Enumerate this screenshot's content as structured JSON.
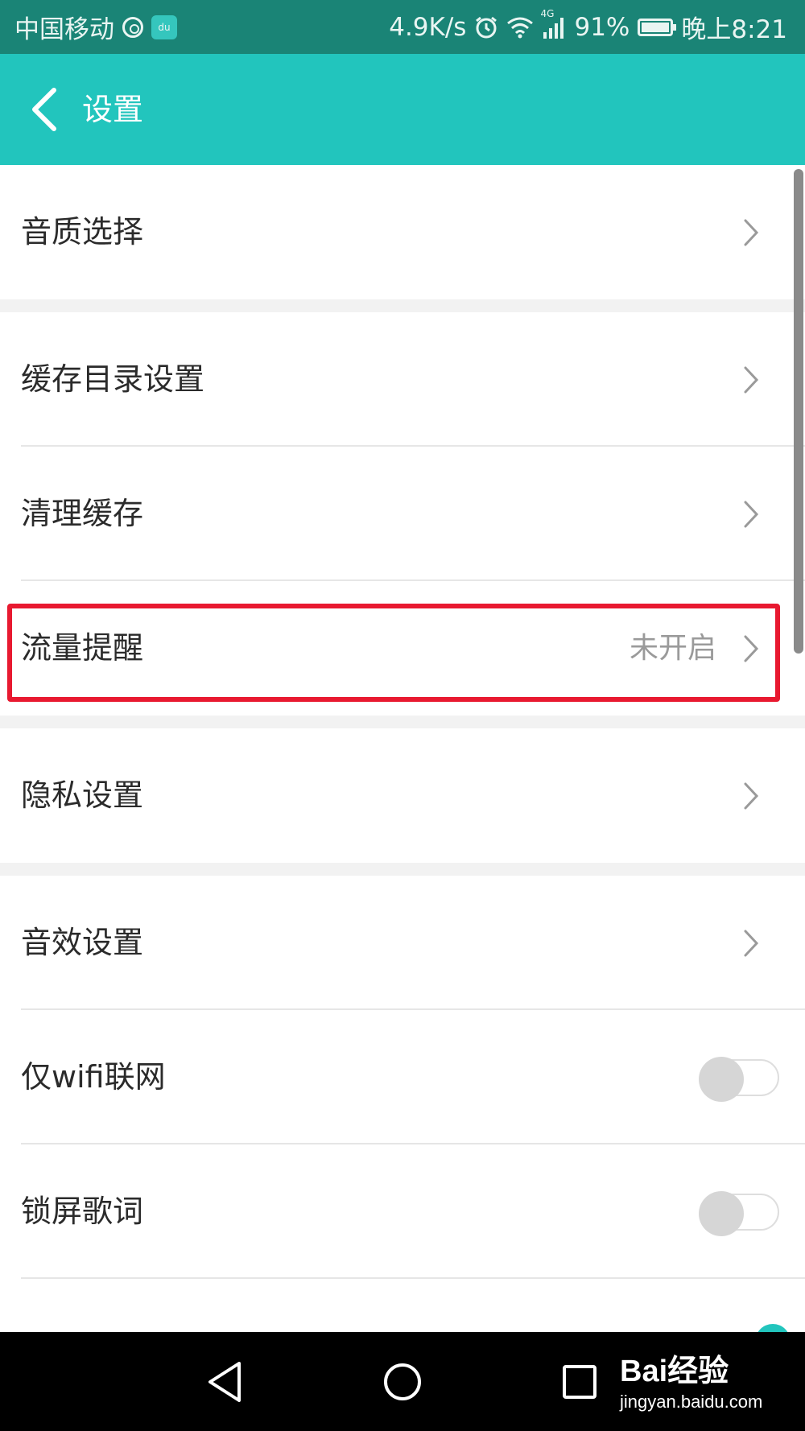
{
  "status_bar": {
    "carrier": "中国移动",
    "speed": "4.9K/s",
    "network_type": "4G",
    "battery": "91%",
    "time": "晚上8:21",
    "icons": [
      "netease-music-icon",
      "du-music-icon",
      "alarm-icon",
      "wifi-icon",
      "signal-icon",
      "battery-icon"
    ]
  },
  "header": {
    "title": "设置",
    "back_icon": "chevron-left-icon",
    "background": "#22c5bd"
  },
  "settings": {
    "audio_quality": "音质选择",
    "cache_dir": "缓存目录设置",
    "clear_cache": "清理缓存",
    "data_alert": "流量提醒",
    "data_alert_status": "未开启",
    "privacy": "隐私设置",
    "sound_effects": "音效设置",
    "wifi_only": "仅wifi联网",
    "wifi_only_on": false,
    "lock_lyrics": "锁屏歌词",
    "lock_lyrics_on": false
  },
  "highlight_color": "#e81930",
  "nav_bar": {
    "icons": [
      "back-triangle-icon",
      "home-circle-icon",
      "recents-square-icon"
    ]
  },
  "watermark": {
    "logo": "Bai经验",
    "url": "jingyan.baidu.com"
  }
}
